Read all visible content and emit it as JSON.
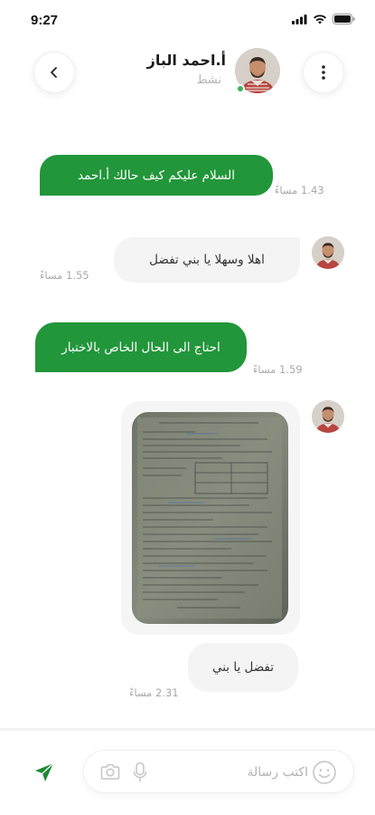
{
  "status_bar": {
    "time": "9:27"
  },
  "header": {
    "contact_name": "أ.احمد الباز",
    "contact_status": "نشط"
  },
  "messages": [
    {
      "direction": "out",
      "text": "السلام عليكم كيف حالك أ.احمد",
      "time": "1.43 مساءً"
    },
    {
      "direction": "in",
      "text": "اهلا وسهلا يا بني تفضل",
      "time": "1.55 مساءً"
    },
    {
      "direction": "out",
      "text": "احتاج الى الحال الخاص بالاختبار",
      "time": "1.59 مساءً"
    },
    {
      "direction": "in",
      "type": "image",
      "image": "document-photo"
    },
    {
      "direction": "in",
      "text": "تفضل يا بني",
      "time": "2.31 مساءً"
    }
  ],
  "composer": {
    "placeholder": "اكتب رسالة",
    "value": ""
  },
  "icons": {
    "back": "chevron-left-icon",
    "more": "more-vertical-icon",
    "emoji": "smile-icon",
    "mic": "mic-icon",
    "camera": "camera-icon",
    "send": "send-icon"
  },
  "colors": {
    "accent": "#22963a",
    "online": "#35b35a",
    "incoming_bubble": "#f4f4f4"
  }
}
